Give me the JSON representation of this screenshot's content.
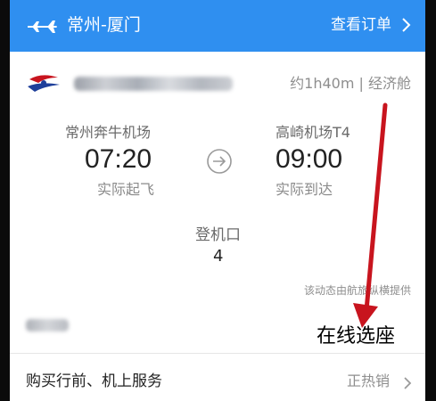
{
  "header": {
    "icon": "airplane-icon",
    "route": "常州-厦门",
    "view_order": "查看订单"
  },
  "flight": {
    "airline_logo": "china-eastern-logo",
    "duration_class": "约1h40m | 经济舱",
    "departure": {
      "airport": "常州奔牛机场",
      "time": "07:20",
      "status": "实际起飞"
    },
    "arrival": {
      "airport": "高崎机场T4",
      "time": "09:00",
      "status": "实际到达"
    },
    "gate_label": "登机口",
    "gate_value": "4",
    "source_note": "该动态由航旅纵横提供"
  },
  "annotation": {
    "text": "在线选座",
    "arrow_color": "#c8141e"
  },
  "services": {
    "label": "购买行前、机上服务",
    "status": "正热销"
  },
  "colors": {
    "header_bg": "#2f8ff0",
    "outer_bg": "#0b0b0b"
  }
}
